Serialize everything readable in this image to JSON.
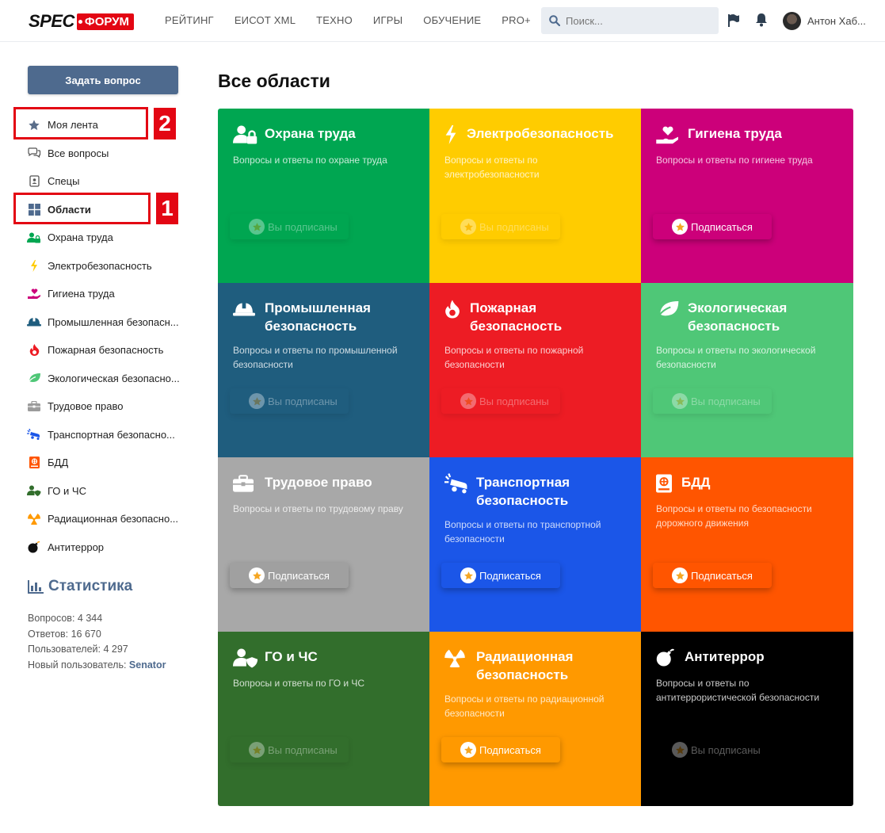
{
  "header": {
    "logo_spec": "SPEC",
    "logo_forum": "ФОРУМ",
    "nav": [
      "РЕЙТИНГ",
      "ЕИСОТ XML",
      "ТЕХНО",
      "ИГРЫ",
      "ОБУЧЕНИЕ",
      "PRO+"
    ],
    "search_placeholder": "Поиск...",
    "username": "Антон Хаб..."
  },
  "sidebar": {
    "ask_button": "Задать вопрос",
    "items": [
      {
        "label": "Моя лента",
        "icon": "star-icon"
      },
      {
        "label": "Все вопросы",
        "icon": "chat-icon"
      },
      {
        "label": "Спецы",
        "icon": "contact-card-icon"
      },
      {
        "label": "Области",
        "icon": "grid-icon"
      },
      {
        "label": "Охрана труда",
        "icon": "user-lock-icon"
      },
      {
        "label": "Электробезопасность",
        "icon": "bolt-icon"
      },
      {
        "label": "Гигиена труда",
        "icon": "hand-heart-icon"
      },
      {
        "label": "Промышленная безопасн...",
        "icon": "hard-hat-icon"
      },
      {
        "label": "Пожарная безопасность",
        "icon": "fire-icon"
      },
      {
        "label": "Экологическая безопасно...",
        "icon": "leaf-icon"
      },
      {
        "label": "Трудовое право",
        "icon": "briefcase-icon"
      },
      {
        "label": "Транспортная безопасно...",
        "icon": "car-crash-icon"
      },
      {
        "label": "БДД",
        "icon": "road-book-icon"
      },
      {
        "label": "ГО и ЧС",
        "icon": "user-shield-icon"
      },
      {
        "label": "Радиационная безопасно...",
        "icon": "radiation-icon"
      },
      {
        "label": "Антитеррор",
        "icon": "bomb-icon"
      }
    ],
    "annotations": [
      "2",
      "1"
    ]
  },
  "stats": {
    "title": "Статистика",
    "questions": "Вопросов: 4 344",
    "answers": "Ответов: 16 670",
    "users": "Пользователей: 4 297",
    "new_user_label": "Новый пользователь: ",
    "new_user_name": "Senator"
  },
  "main": {
    "title": "Все области",
    "tiles": [
      {
        "title": "Охрана труда",
        "desc": "Вопросы и ответы по охране труда",
        "button": "Вы подписаны",
        "subscribed": true,
        "color": "#00a651",
        "icon": "user-lock-icon"
      },
      {
        "title": "Электробезопасность",
        "desc": "Вопросы и ответы по электробезопасности",
        "button": "Вы подписаны",
        "subscribed": true,
        "color": "#ffcc00",
        "icon": "bolt-icon"
      },
      {
        "title": "Гигиена труда",
        "desc": "Вопросы и ответы по гигиене труда",
        "button": "Подписаться",
        "subscribed": false,
        "color": "#cc007a",
        "icon": "hand-heart-icon"
      },
      {
        "title": "Промышленная безопасность",
        "desc": "Вопросы и ответы по промышленной безопасности",
        "button": "Вы подписаны",
        "subscribed": true,
        "color": "#1f5d7e",
        "icon": "hard-hat-icon"
      },
      {
        "title": "Пожарная безопасность",
        "desc": "Вопросы и ответы по пожарной безопасности",
        "button": "Вы подписаны",
        "subscribed": true,
        "color": "#ed1c24",
        "icon": "fire-icon"
      },
      {
        "title": "Экологическая безопасность",
        "desc": "Вопросы и ответы по экологической безопасности",
        "button": "Вы подписаны",
        "subscribed": true,
        "color": "#4fc777",
        "icon": "leaf-icon"
      },
      {
        "title": "Трудовое право",
        "desc": "Вопросы и ответы по трудовому праву",
        "button": "Подписаться",
        "subscribed": false,
        "color": "#a8a8a8",
        "icon": "briefcase-icon"
      },
      {
        "title": "Транспортная безопасность",
        "desc": "Вопросы и ответы по транспортной безопасности",
        "button": "Подписаться",
        "subscribed": false,
        "color": "#1b56e8",
        "icon": "car-crash-icon"
      },
      {
        "title": "БДД",
        "desc": "Вопросы и ответы по безопасности дорожного движения",
        "button": "Подписаться",
        "subscribed": false,
        "color": "#ff5500",
        "icon": "road-book-icon"
      },
      {
        "title": "ГО и ЧС",
        "desc": "Вопросы и ответы по ГО и ЧС",
        "button": "Вы подписаны",
        "subscribed": true,
        "color": "#326e2c",
        "icon": "user-shield-icon"
      },
      {
        "title": "Радиационная безопасность",
        "desc": "Вопросы и ответы по радиационной безопасности",
        "button": "Подписаться",
        "subscribed": false,
        "color": "#ff9900",
        "icon": "radiation-icon"
      },
      {
        "title": "Антитеррор",
        "desc": "Вопросы и ответы по антитеррористической безопасности",
        "button": "Вы подписаны",
        "subscribed": true,
        "color": "#000000",
        "icon": "bomb-icon"
      }
    ]
  },
  "colors": {
    "accent": "#4e6a8e",
    "annotation": "#e30613",
    "star": "#f5a623"
  }
}
